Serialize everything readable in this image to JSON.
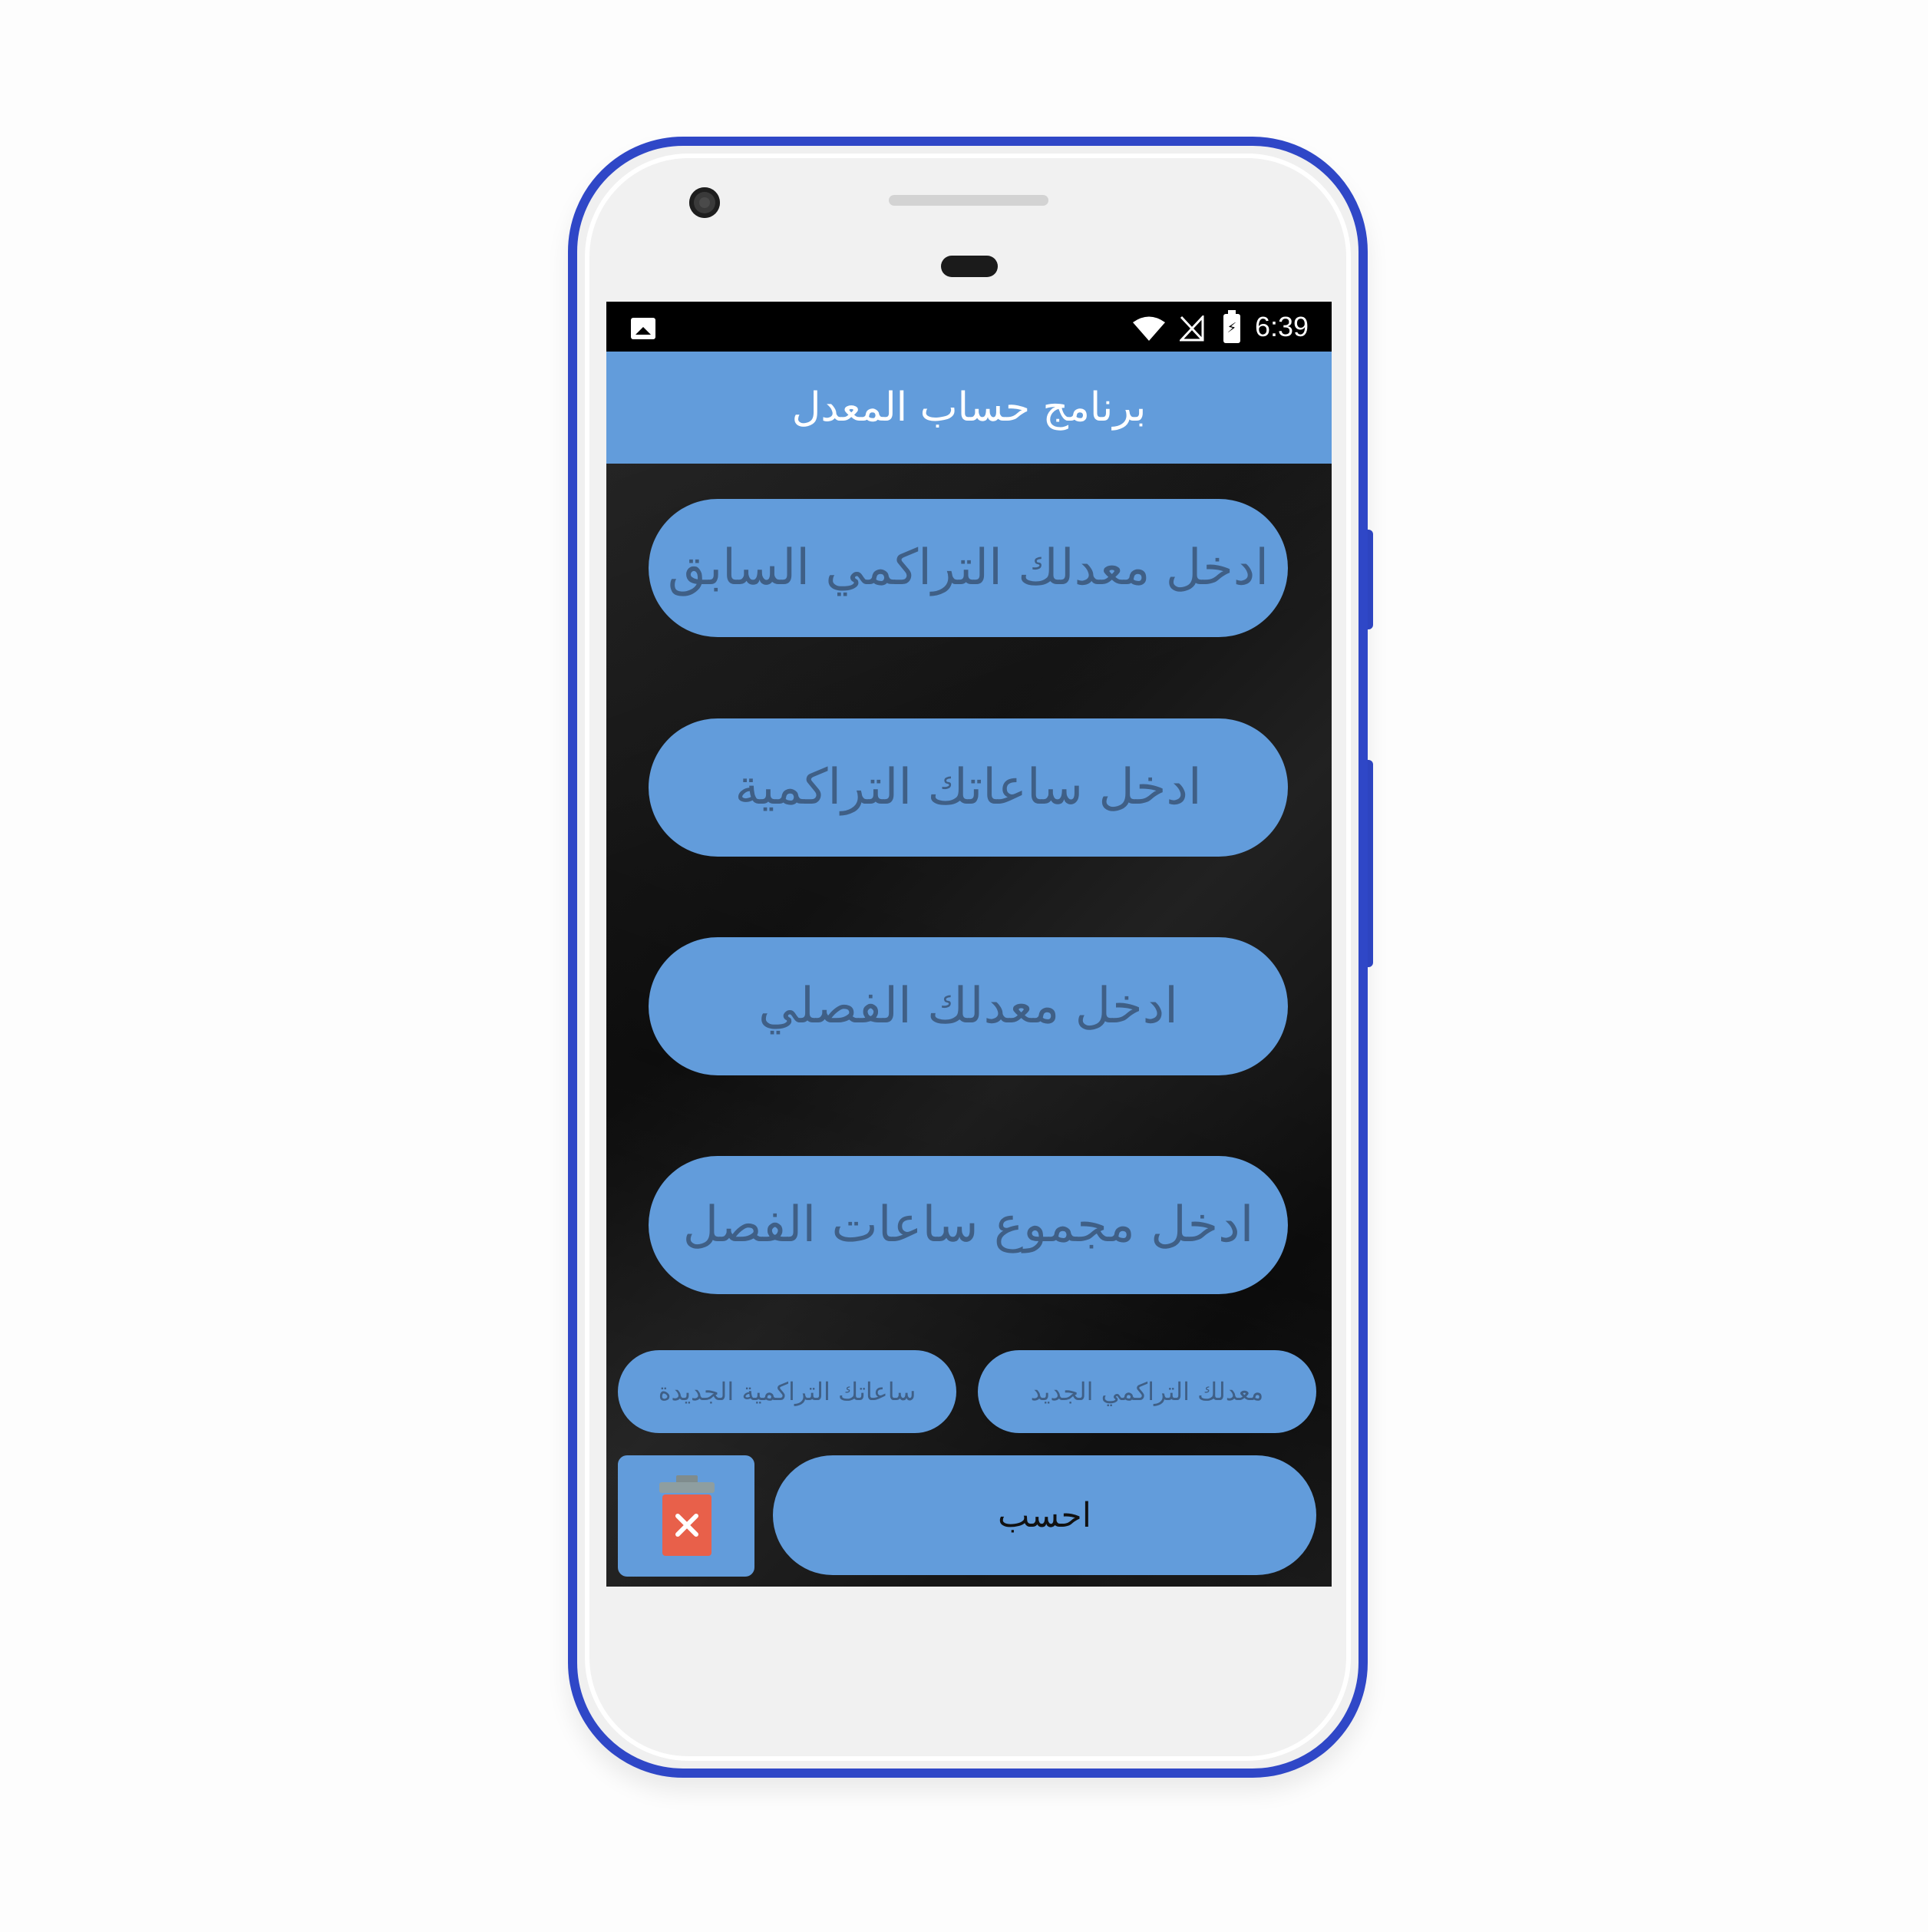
{
  "statusbar": {
    "time": "6:39",
    "icons": [
      "image-icon",
      "wifi-icon",
      "signal-icon",
      "battery-charging-icon"
    ]
  },
  "appbar": {
    "title": "برنامج حساب المعدل"
  },
  "inputs": [
    {
      "placeholder": "ادخل معدلك التراكمي السابق"
    },
    {
      "placeholder": "ادخل ساعاتك التراكمية"
    },
    {
      "placeholder": "ادخل معدلك الفصلي"
    },
    {
      "placeholder": "ادخل مجموع ساعات الفصل"
    }
  ],
  "results": {
    "new_hours_label": "ساعاتك التراكمية الجديدة",
    "new_gpa_label": "معدلك التراكمي الجديد"
  },
  "actions": {
    "calculate_label": "احسب",
    "clear_icon": "trash-clear-icon"
  },
  "colors": {
    "accent": "#629cdb",
    "phone_frame": "#2f47c7",
    "field_text": "#3f5f86",
    "clear_badge": "#e8604a"
  }
}
